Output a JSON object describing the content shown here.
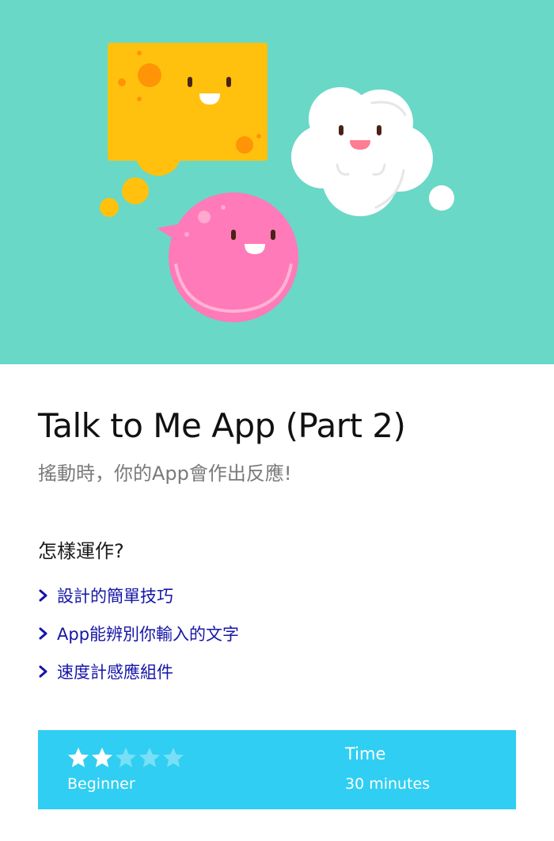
{
  "hero": {
    "background": "#69d8c7",
    "characters": [
      "yellow-speech-bubble-character",
      "white-cloud-character",
      "pink-speech-bubble-character"
    ]
  },
  "lesson": {
    "title": "Talk to Me App (Part 2)",
    "subtitle": "搖動時，你的App會作出反應!"
  },
  "how_it_works": {
    "heading": "怎樣運作?",
    "items": [
      {
        "label": "設計的簡單技巧",
        "icon": "chevron-right-icon"
      },
      {
        "label": "App能辨別你輸入的文字",
        "icon": "chevron-right-icon"
      },
      {
        "label": "速度計感應組件",
        "icon": "chevron-right-icon"
      }
    ]
  },
  "info": {
    "background": "#30cef2",
    "difficulty": {
      "rating": 2,
      "max": 5,
      "label": "Beginner"
    },
    "time": {
      "label": "Time",
      "value": "30 minutes"
    }
  },
  "colors": {
    "accent_link": "#1515a8",
    "yellow": "#ffc10e",
    "pink": "#ff7ab8",
    "cloud": "#ffffff"
  }
}
